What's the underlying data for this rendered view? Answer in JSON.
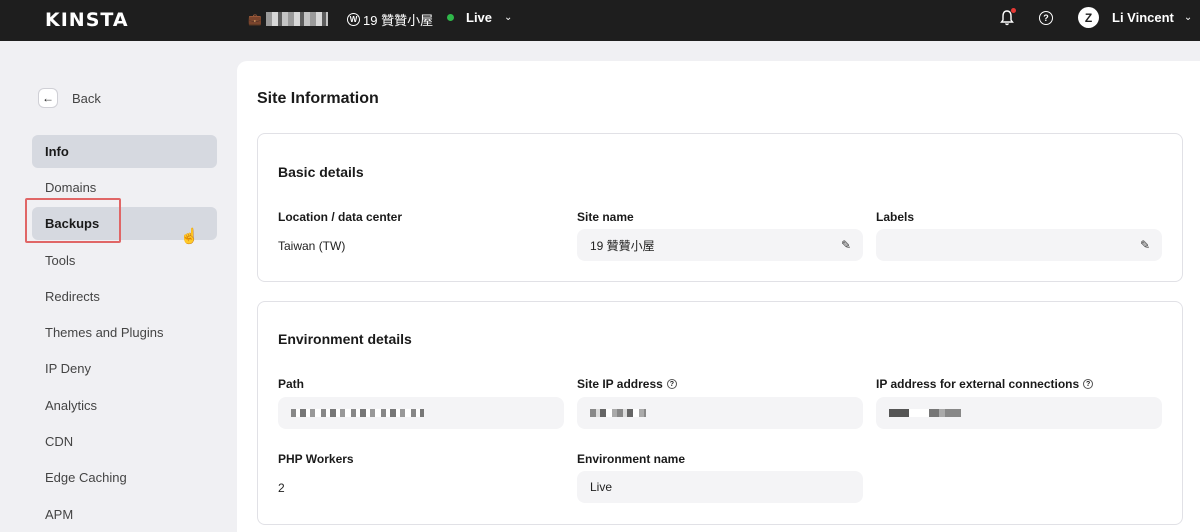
{
  "topbar": {
    "logo": "KINSTA",
    "site_label": "19 贊贊小屋",
    "environment": "Live",
    "user_name": "Li Vincent",
    "bell_icon": "bell-icon",
    "help_icon": "question-circle-icon"
  },
  "sidebar": {
    "back_label": "Back",
    "items": [
      {
        "label": "Info"
      },
      {
        "label": "Domains"
      },
      {
        "label": "Backups"
      },
      {
        "label": "Tools"
      },
      {
        "label": "Redirects"
      },
      {
        "label": "Themes and Plugins"
      },
      {
        "label": "IP Deny"
      },
      {
        "label": "Analytics"
      },
      {
        "label": "CDN"
      },
      {
        "label": "Edge Caching"
      },
      {
        "label": "APM"
      }
    ],
    "active": "Info",
    "highlighted": "Backups"
  },
  "main": {
    "title": "Site Information",
    "basic": {
      "title": "Basic details",
      "location_label": "Location / data center",
      "location_value": "Taiwan (TW)",
      "site_name_label": "Site name",
      "site_name_value": "19 贊贊小屋",
      "labels_label": "Labels",
      "labels_value": ""
    },
    "environment": {
      "title": "Environment details",
      "path_label": "Path",
      "site_ip_label": "Site IP address",
      "external_ip_label": "IP address for external connections",
      "php_workers_label": "PHP Workers",
      "php_workers_value": "2",
      "env_name_label": "Environment name",
      "env_name_value": "Live"
    }
  },
  "colors": {
    "topbar_bg": "#1e1e1e",
    "live_dot": "#2fb84a",
    "active_nav_bg": "#d6d9e0",
    "highlight_border": "#e06666"
  }
}
